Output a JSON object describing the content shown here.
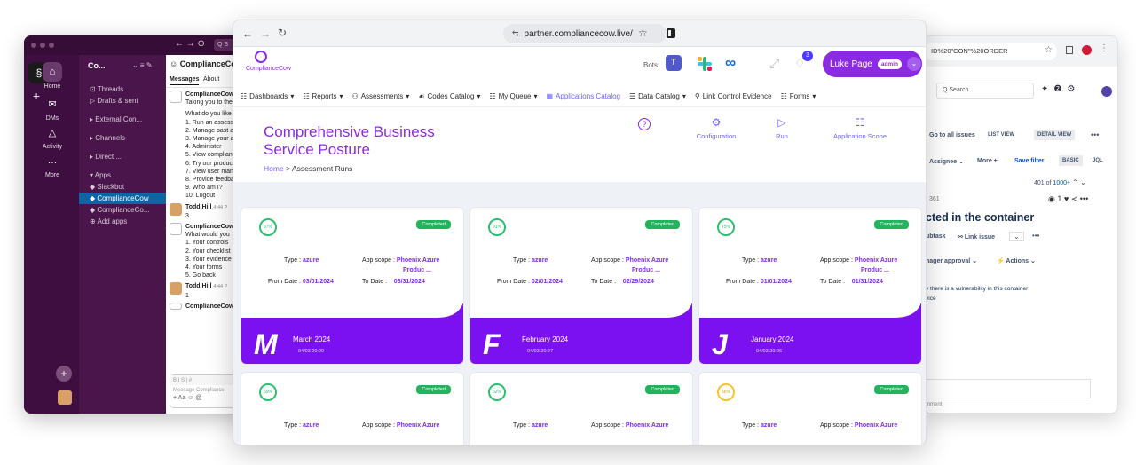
{
  "slack": {
    "workspace": "Co...",
    "app_name": "ComplianceCow",
    "rail": [
      "Home",
      "DMs",
      "Activity",
      "More"
    ],
    "channels": [
      "Threads",
      "Drafts & sent",
      "External Con...",
      "Channels",
      "Direct ...",
      "Apps",
      "Slackbot",
      "ComplianceCow",
      "ComplianceCo...",
      "Add apps"
    ],
    "tabs": [
      "Messages",
      "About"
    ],
    "messages": [
      {
        "author": "ComplianceCow",
        "text": "Taking you to the"
      },
      {
        "lines": [
          "What do you like",
          "1. Run an assess",
          "2. Manage past a",
          "3. Manage your a",
          "4. Administer",
          "5. View complian",
          "6. Try our produc",
          "7. View user man",
          "8. Provide feedba",
          "9. Who am I?",
          "10. Logout"
        ]
      },
      {
        "author": "Todd Hill",
        "time": "4:44 P",
        "text": "3"
      },
      {
        "author": "ComplianceCow",
        "text": "What would you"
      },
      {
        "lines": [
          "1. Your controls",
          "2. Your checklist",
          "3. Your evidence",
          "4. Your forms",
          "5. Go back"
        ]
      },
      {
        "author": "Todd Hill",
        "time": "4:44 P",
        "text": "1"
      },
      {
        "author": "ComplianceCow"
      }
    ],
    "composer_placeholder": "Message Compliance",
    "composer_tools": "+ Aa ☺ @"
  },
  "jira": {
    "url_fragment": "ID%20\"CON\"%20ORDER",
    "search_placeholder": "Search",
    "go_to_all": "Go to all issues",
    "list_view": "LIST VIEW",
    "detail_view": "DETAIL VIEW",
    "assignee": "Assignee",
    "more": "More",
    "save_filter": "Save filter",
    "basic": "BASIC",
    "jql": "JQL",
    "count": "401 of",
    "count_total": "1000+",
    "issue_key": "361",
    "watchers": "1",
    "title": "cted in the container",
    "subtask": "ubtask",
    "link_issue": "Link issue",
    "approval": "nager approval",
    "actions": "Actions",
    "desc1": "y there is a vulnerability in this container",
    "desc2": "vice",
    "comment_hint": "mment"
  },
  "browser": {
    "url": "partner.compliancecow.live/"
  },
  "app": {
    "logo_text": "ComplianceCow",
    "bots_label": "Bots:",
    "notification_count": "3",
    "user_name": "Luke Page",
    "user_role": "admin",
    "menu": [
      {
        "label": "Dashboards",
        "icon": "☷"
      },
      {
        "label": "Reports",
        "icon": "☷"
      },
      {
        "label": "Assessments",
        "icon": "⚇"
      },
      {
        "label": "Codes Catalog",
        "icon": "☙"
      },
      {
        "label": "My Queue",
        "icon": "☷"
      },
      {
        "label": "Applications Catalog",
        "icon": "▦"
      },
      {
        "label": "Data Catalog",
        "icon": "☰"
      },
      {
        "label": "Link Control Evidence",
        "icon": "⚲"
      },
      {
        "label": "Forms",
        "icon": "☷"
      }
    ],
    "page_title": "Comprehensive Business Service Posture",
    "breadcrumb_home": "Home",
    "breadcrumb_sep": ">",
    "breadcrumb_current": "Assessment Runs",
    "help_icon": "?",
    "actions": [
      {
        "label": "Configuration",
        "icon": "⚙"
      },
      {
        "label": "Run",
        "icon": "▷"
      },
      {
        "label": "Application Scope",
        "icon": "☷"
      }
    ],
    "card_labels": {
      "type": "Type :",
      "scope": "App scope :",
      "from": "From Date :",
      "to": "To Date :"
    },
    "cards": [
      {
        "score": "97",
        "status": "Completed",
        "type": "azure",
        "scope1": "Phoenix Azure",
        "scope2": "Produc ...",
        "from": "03/01/2024",
        "to": "03/31/2024",
        "letter": "M",
        "month": "March 2024",
        "stamp": "04/03 20:29"
      },
      {
        "score": "91",
        "status": "Completed",
        "type": "azure",
        "scope1": "Phoenix Azure",
        "scope2": "Produc ...",
        "from": "02/01/2024",
        "to": "02/29/2024",
        "letter": "F",
        "month": "February 2024",
        "stamp": "04/03 20:27"
      },
      {
        "score": "75",
        "status": "Completed",
        "type": "azure",
        "scope1": "Phoenix Azure",
        "scope2": "Produc ...",
        "from": "01/01/2024",
        "to": "01/31/2024",
        "letter": "J",
        "month": "January 2024",
        "stamp": "04/03 20:26"
      },
      {
        "score": "69",
        "status": "Completed",
        "type": "azure",
        "scope1": "Phoenix Azure"
      },
      {
        "score": "62",
        "status": "Completed",
        "type": "azure",
        "scope1": "Phoenix Azure"
      },
      {
        "score": "56",
        "status": "Completed",
        "type": "azure",
        "scope1": "Phoenix Azure"
      }
    ],
    "colors": {
      "accent": "#8a2be2",
      "link": "#6c63ff",
      "completed": "#24b35d",
      "card_footer": "#7b11f0"
    }
  }
}
